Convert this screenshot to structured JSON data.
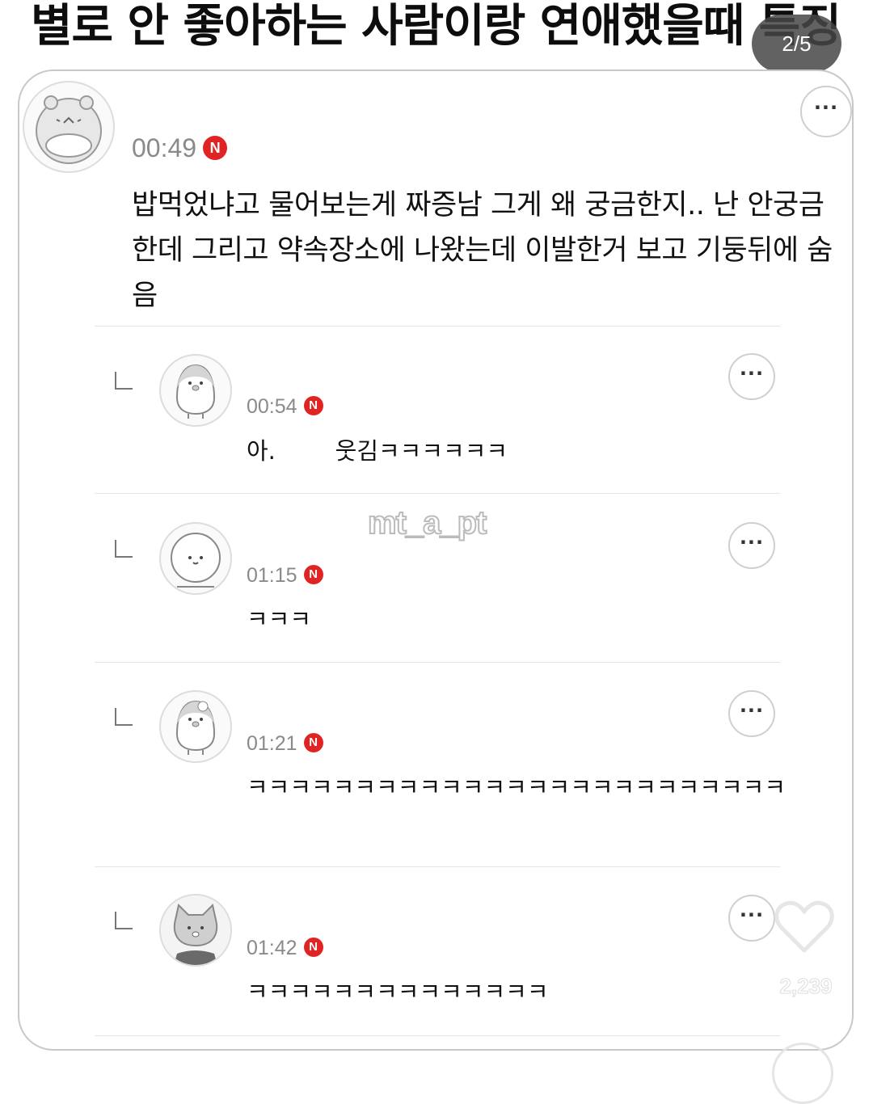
{
  "post": {
    "title": "별로 안 좋아하는 사람이랑 연애했을때 특징",
    "page_indicator": "2/5",
    "watermark": "mt_a_pt",
    "like_count": "2,239"
  },
  "main_comment": {
    "time": "00:49",
    "badge": "N",
    "text": "밥먹었냐고 물어보는게 짜증남 그게 왜 궁금한지.. 난 안궁금한데 그리고 약속장소에 나왔는데 이발한거 보고 기둥뒤에 숨음",
    "more": "···"
  },
  "replies": [
    {
      "time": "00:54",
      "badge": "N",
      "text": "아.        웃김ㅋㅋㅋㅋㅋㅋ",
      "more": "···"
    },
    {
      "time": "01:15",
      "badge": "N",
      "text": "ㅋㅋㅋ",
      "more": "···"
    },
    {
      "time": "01:21",
      "badge": "N",
      "text": "ㅋㅋㅋㅋㅋㅋㅋㅋㅋㅋㅋㅋㅋㅋㅋㅋㅋㅋㅋㅋㅋㅋㅋㅋㅋ",
      "more": "···"
    },
    {
      "time": "01:42",
      "badge": "N",
      "text": "ㅋㅋㅋㅋㅋㅋㅋㅋㅋㅋㅋㅋㅋㅋ",
      "more": "···"
    }
  ],
  "colors": {
    "badge": "#e02424",
    "timestamp": "#8a8a8a",
    "divider": "#e6e6e6"
  },
  "icons": {
    "more": "more-dots-icon",
    "reply": "reply-corner-icon",
    "like": "heart-icon"
  }
}
